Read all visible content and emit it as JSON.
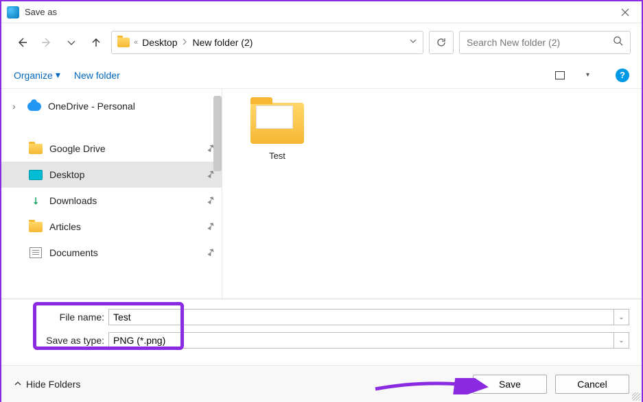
{
  "window": {
    "title": "Save as"
  },
  "nav": {
    "breadcrumb": {
      "root_glyph": "«",
      "seg1": "Desktop",
      "seg2": "New folder (2)"
    },
    "search_placeholder": "Search New folder (2)"
  },
  "toolbar": {
    "organize": "Organize",
    "new_folder": "New folder"
  },
  "tree": {
    "onedrive": "OneDrive - Personal",
    "gdrive": "Google Drive",
    "desktop": "Desktop",
    "downloads": "Downloads",
    "articles": "Articles",
    "documents": "Documents"
  },
  "content": {
    "items": [
      {
        "name": "Test"
      }
    ]
  },
  "fields": {
    "filename_label": "File name:",
    "filename_value": "Test",
    "type_label": "Save as type:",
    "type_value": "PNG (*.png)"
  },
  "footer": {
    "hide": "Hide Folders",
    "save": "Save",
    "cancel": "Cancel"
  }
}
